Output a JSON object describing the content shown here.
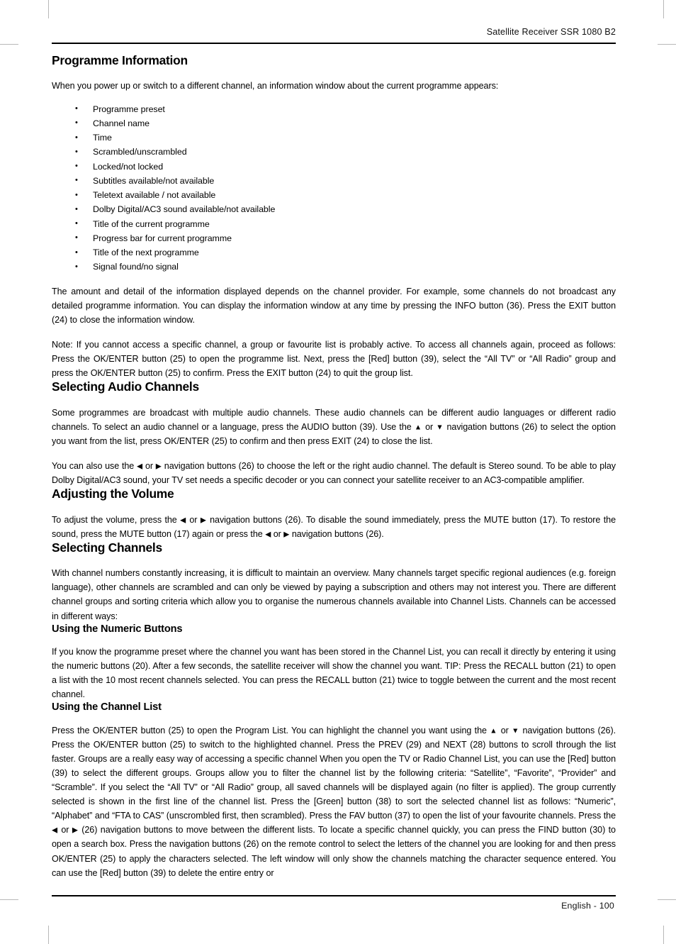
{
  "page": {
    "running_head": "Satellite Receiver SSR 1080 B2",
    "folio": "English  -  100"
  },
  "sections": [
    {
      "id": "programme-information",
      "heading": "Programme Information",
      "level": 1,
      "intro": "When you power up or switch to a different channel, an information window about the current programme appears:",
      "bullets": [
        "Programme preset",
        "Channel name",
        "Time",
        "Scrambled/unscrambled",
        "Locked/not locked",
        "Subtitles available/not available",
        "Teletext available / not available",
        "Dolby Digital/AC3 sound available/not available",
        "Title of the current programme",
        "Progress bar for current programme",
        "Title of the next programme",
        "Signal found/no signal"
      ],
      "paragraphs": [
        "The amount and detail of the information displayed depends on the channel provider. For example, some channels do not broadcast any detailed programme information. You can display the information window at any time by pressing the INFO button (36). Press the EXIT button (24) to close the information window.",
        "Note: If you cannot access a specific channel, a group or favourite list is probably active. To  access all channels again, proceed as follows: Press the OK/ENTER button (25) to open the programme list. Next, press the [Red] button (39), select the “All TV” or “All Radio” group and press the OK/ENTER button (25) to confirm. Press the EXIT button (24) to quit the group list."
      ]
    },
    {
      "id": "selecting-audio-channels",
      "heading": "Selecting Audio Channels",
      "level": 1,
      "para_1_a": "Some programmes are broadcast with multiple audio channels. These audio channels can be different audio languages or different radio channels. To select an audio channel or a language, press the AUDIO button (39). Use the ",
      "para_1_arrow_up": "▲",
      "para_1_b": " or ",
      "para_1_arrow_down": "▼",
      "para_1_c": " navigation buttons (26) to select the option you want from the list, press OK/ENTER (25) to confirm and then press EXIT (24) to close the list.",
      "para_2_a": "You can also use the ",
      "para_2_arrow_left": "◀",
      "para_2_b": " or ",
      "para_2_arrow_right": "▶",
      "para_2_c": " navigation buttons (26) to choose the left or the right audio channel. The default is Stereo sound. To be able to play Dolby Digital/AC3 sound, your TV set needs a specific decoder or you can connect your satellite receiver to an AC3-compatible amplifier."
    },
    {
      "id": "adjusting-the-volume",
      "heading": "Adjusting the Volume",
      "level": 1,
      "para_a": "To adjust the volume, press the ",
      "arrow_left_1": "◀",
      "para_b": " or ",
      "arrow_right_1": "▶",
      "para_c": " navigation buttons (26). To disable the sound immediately, press the MUTE button (17). To restore the sound, press the MUTE button (17) again or press the ",
      "arrow_left_2": "◀",
      "para_d": " or ",
      "arrow_right_2": "▶",
      "para_e": " navigation buttons (26)."
    },
    {
      "id": "selecting-channels",
      "heading": "Selecting Channels",
      "level": 1,
      "paragraphs": [
        "With channel numbers constantly increasing, it is difficult to maintain an overview. Many channels target specific regional audiences (e.g. foreign language), other channels are scrambled and can only be viewed by paying a subscription and others may not interest you.  There are different channel groups and sorting criteria which allow you to organise the numerous channels available into Channel Lists. Channels can be accessed in different ways:"
      ]
    },
    {
      "id": "using-the-numeric-buttons",
      "heading": "Using the Numeric Buttons",
      "level": 2,
      "paragraphs": [
        "If you know the programme preset where the channel you want has been stored in the Channel List, you can recall it directly by entering it using the numeric buttons (20). After a few seconds, the satellite receiver will show the channel you want. TIP: Press the RECALL button (21) to open a list with the 10 most recent channels selected. You can press the RECALL button (21) twice to toggle between the current and the most recent channel."
      ]
    },
    {
      "id": "using-the-channel-list",
      "heading": "Using the Channel List",
      "level": 2,
      "para_a": "Press the OK/ENTER button (25) to open the Program List. You can highlight the channel you want using the ",
      "arrow_up": "▲",
      "para_b": " or ",
      "arrow_down": "▼",
      "para_c": " navigation buttons (26). Press the OK/ENTER button (25) to switch to the highlighted channel. Press the PREV (29) and NEXT (28) buttons to scroll through the list faster. Groups are a really easy way of accessing a specific channel When you open the TV or Radio Channel List, you can use the [Red] button (39) to select the different groups. Groups allow you to filter the channel list by the following criteria: “Satellite”, “Favorite”, “Provider” and “Scramble”. If you select the “All TV” or “All Radio” group, all saved channels will be displayed again (no filter is applied). The group currently selected is shown in the first line of the channel list. Press the [Green] button (38) to sort the selected channel list as follows: “Numeric”, “Alphabet” and “FTA to CAS” (unscrombled first, then scrambled). Press the FAV button (37) to open the list of your favourite channels. Press the ",
      "arrow_left": "◀",
      "para_d": " or ",
      "arrow_right": "▶",
      "para_e": " (26) navigation buttons to move between the different lists. To locate a specific channel quickly, you can press the FIND button (30) to open a search box. Press the navigation buttons (26) on the remote control to select the letters of the channel you are looking for and then press OK/ENTER (25) to apply the characters selected. The left window will only show the channels matching the character sequence entered. You can use the [Red] button (39) to delete the entire entry or"
    }
  ]
}
